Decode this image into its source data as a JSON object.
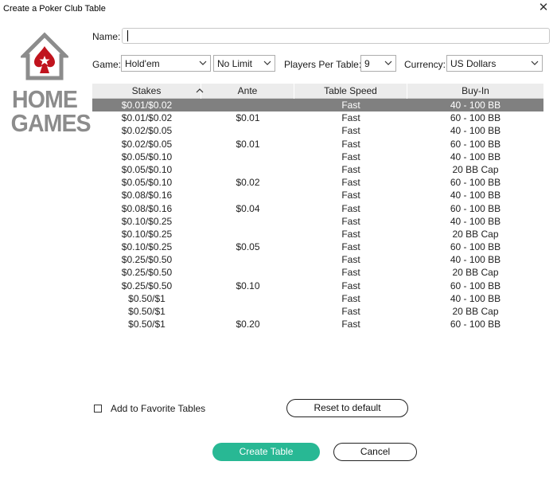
{
  "window": {
    "title": "Create a Poker Club Table",
    "close_glyph": "✕"
  },
  "logo": {
    "line1": "HOME",
    "line2": "GAMES",
    "house_color": "#8c8c8c",
    "spade_color": "#c0131d"
  },
  "form": {
    "name_label": "Name:",
    "name_value": "",
    "game_label": "Game:",
    "game_value": "Hold'em",
    "limit_value": "No Limit",
    "players_label": "Players Per Table:",
    "players_value": "9",
    "currency_label": "Currency:",
    "currency_value": "US Dollars"
  },
  "table": {
    "columns": [
      "Stakes",
      "Ante",
      "Table Speed",
      "Buy-In"
    ],
    "sort_column": "Stakes",
    "selected_row": 0,
    "rows": [
      [
        "$0.01/$0.02",
        "",
        "Fast",
        "40 - 100 BB"
      ],
      [
        "$0.01/$0.02",
        "$0.01",
        "Fast",
        "60 - 100 BB"
      ],
      [
        "$0.02/$0.05",
        "",
        "Fast",
        "40 - 100 BB"
      ],
      [
        "$0.02/$0.05",
        "$0.01",
        "Fast",
        "60 - 100 BB"
      ],
      [
        "$0.05/$0.10",
        "",
        "Fast",
        "40 - 100 BB"
      ],
      [
        "$0.05/$0.10",
        "",
        "Fast",
        "20 BB Cap"
      ],
      [
        "$0.05/$0.10",
        "$0.02",
        "Fast",
        "60 - 100 BB"
      ],
      [
        "$0.08/$0.16",
        "",
        "Fast",
        "40 - 100 BB"
      ],
      [
        "$0.08/$0.16",
        "$0.04",
        "Fast",
        "60 - 100 BB"
      ],
      [
        "$0.10/$0.25",
        "",
        "Fast",
        "40 - 100 BB"
      ],
      [
        "$0.10/$0.25",
        "",
        "Fast",
        "20 BB Cap"
      ],
      [
        "$0.10/$0.25",
        "$0.05",
        "Fast",
        "60 - 100 BB"
      ],
      [
        "$0.25/$0.50",
        "",
        "Fast",
        "40 - 100 BB"
      ],
      [
        "$0.25/$0.50",
        "",
        "Fast",
        "20 BB Cap"
      ],
      [
        "$0.25/$0.50",
        "$0.10",
        "Fast",
        "60 - 100 BB"
      ],
      [
        "$0.50/$1",
        "",
        "Fast",
        "40 - 100 BB"
      ],
      [
        "$0.50/$1",
        "",
        "Fast",
        "20 BB Cap"
      ],
      [
        "$0.50/$1",
        "$0.20",
        "Fast",
        "60 - 100 BB"
      ]
    ]
  },
  "favorites": {
    "label": "Add to Favorite Tables",
    "checked": false
  },
  "buttons": {
    "reset": "Reset to default",
    "create": "Create Table",
    "cancel": "Cancel",
    "create_color": "#28b894"
  },
  "colors": {
    "selected_row": "#808080",
    "header_bg": "#ececec"
  }
}
